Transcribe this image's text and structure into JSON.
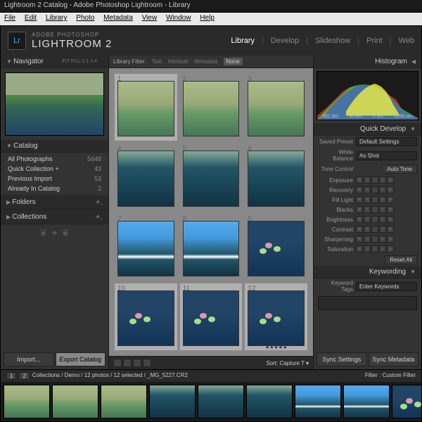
{
  "window": {
    "title": "Lightroom 2 Catalog - Adobe Photoshop Lightroom - Library"
  },
  "menu": [
    "File",
    "Edit",
    "Library",
    "Photo",
    "Metadata",
    "View",
    "Window",
    "Help"
  ],
  "brand": {
    "tag": "ADOBE PHOTOSHOP",
    "name": "LIGHTROOM 2",
    "badge": "Lr"
  },
  "modules": [
    "Library",
    "Develop",
    "Slideshow",
    "Print",
    "Web"
  ],
  "activeModule": "Library",
  "navigator": {
    "title": "Navigator",
    "opts": "FIT  FILL  1:1  1:4"
  },
  "catalog": {
    "title": "Catalog",
    "items": [
      {
        "label": "All Photographs",
        "count": "5648"
      },
      {
        "label": "Quick Collection  +",
        "count": "43"
      },
      {
        "label": "Previous Import",
        "count": "53"
      },
      {
        "label": "Already In Catalog",
        "count": "2"
      }
    ]
  },
  "folders": {
    "title": "Folders"
  },
  "collections": {
    "title": "Collections"
  },
  "importBtn": "Import...",
  "exportBtn": "Export Catalog",
  "filterBar": {
    "label": "Library Filter:",
    "items": [
      "Text",
      "Attribute",
      "Metadata",
      "None"
    ],
    "sel": "None"
  },
  "sort": {
    "label": "Sort:",
    "value": "Capture T"
  },
  "histogram": {
    "title": "Histogram",
    "info": [
      "ISO 200",
      "50 mm",
      "f / 9.0",
      "1/200 sec"
    ]
  },
  "quickDev": {
    "title": "Quick Develop",
    "preset": {
      "label": "Saved Preset",
      "value": "Default Settings"
    },
    "wb": {
      "label": "White Balance",
      "value": "As Shot"
    },
    "tone": {
      "label": "Tone Control",
      "auto": "Auto Tone"
    },
    "sliders": [
      "Exposure",
      "Recovery",
      "Fill Light",
      "Blacks",
      "Brightness",
      "Contrast",
      "Sharpening",
      "Saturation"
    ],
    "reset": "Reset All"
  },
  "keywording": {
    "title": "Keywording",
    "tags": "Keyword Tags",
    "ph": "Enter Keywords"
  },
  "syncSettings": "Sync Settings",
  "syncMeta": "Sync Metadata",
  "path": {
    "pages": [
      "1",
      "2"
    ],
    "crumb": "Collections / Demo / 12 photos / 12 selected / _MG_5227.CR2",
    "filter": "Filter :",
    "filterVal": "Custom Filter"
  },
  "thumbs": [
    1,
    2,
    3,
    4,
    5,
    6,
    7,
    8,
    9,
    10,
    11,
    12
  ]
}
